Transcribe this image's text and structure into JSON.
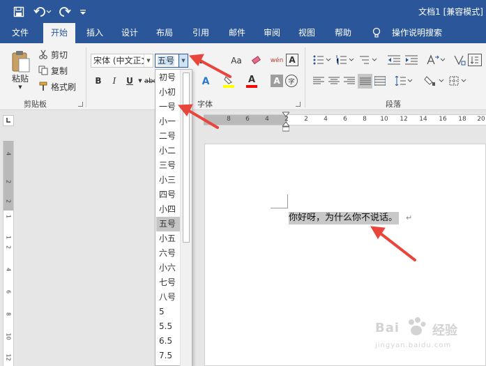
{
  "app": {
    "document_title": "文档1 [兼容模式]"
  },
  "quick_access": {
    "icons": [
      "save-icon",
      "undo-icon",
      "redo-icon",
      "customize-icon"
    ]
  },
  "tabs": [
    {
      "label": "文件",
      "active": false
    },
    {
      "label": "开始",
      "active": true
    },
    {
      "label": "插入",
      "active": false
    },
    {
      "label": "设计",
      "active": false
    },
    {
      "label": "布局",
      "active": false
    },
    {
      "label": "引用",
      "active": false
    },
    {
      "label": "邮件",
      "active": false
    },
    {
      "label": "审阅",
      "active": false
    },
    {
      "label": "视图",
      "active": false
    },
    {
      "label": "帮助",
      "active": false
    }
  ],
  "tell_me": {
    "label": "操作说明搜索",
    "icon": "lightbulb-icon"
  },
  "clipboard": {
    "paste_label": "粘贴",
    "cut_label": "剪切",
    "copy_label": "复制",
    "format_painter_label": "格式刷",
    "group_label": "剪贴板"
  },
  "font": {
    "font_name": "宋体 (中文正文)",
    "font_size": "五号",
    "group_label": "字体",
    "bold": "B",
    "italic": "I",
    "underline": "U",
    "strike": "abc",
    "change_case": "Aa",
    "phonetic": "wén",
    "char_border": "A",
    "text_effect": "A",
    "font_color": "A",
    "char_shading": "A",
    "enclose": "字",
    "grow_font": "A",
    "highlight_color": "#ffff00",
    "font_color_value": "#ff0000"
  },
  "paragraph": {
    "group_label": "段落"
  },
  "font_size_dropdown": {
    "options": [
      "初号",
      "小初",
      "一号",
      "小一",
      "二号",
      "小二",
      "三号",
      "小三",
      "四号",
      "小四",
      "五号",
      "小五",
      "六号",
      "小六",
      "七号",
      "八号",
      "5",
      "5.5",
      "6.5",
      "7.5"
    ],
    "selected": "五号"
  },
  "ruler": {
    "h_numbers": [
      "8",
      "6",
      "4",
      "2",
      "2",
      "4",
      "6",
      "8",
      "10",
      "12",
      "14",
      "16",
      "18",
      "20"
    ],
    "v_numbers": [
      "4",
      "2",
      "2",
      "1",
      "1",
      "2",
      "4",
      "6",
      "8",
      "10",
      "12"
    ]
  },
  "document": {
    "text": "你好呀，为什么你不说话。",
    "paragraph_mark": "↵"
  },
  "annotation_color": "#e8453c",
  "watermark": {
    "brand": "Bai",
    "brand2": "经验",
    "url": "jingyan.baidu.com"
  }
}
